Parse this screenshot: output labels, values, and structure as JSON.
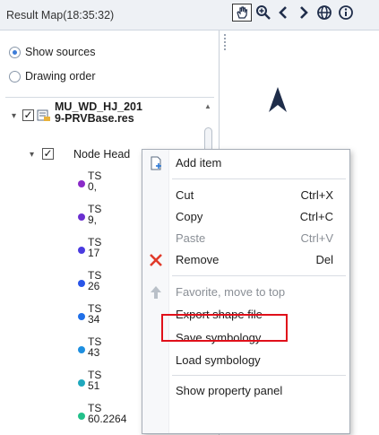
{
  "window": {
    "title": "Result Map(18:35:32)"
  },
  "view_options": {
    "show_sources": "Show sources",
    "drawing_order": "Drawing order",
    "selected": "Show sources"
  },
  "tree": {
    "layer_name_line1": "MU_WD_HJ_201",
    "layer_name_line2": "9-PRVBase.res",
    "node_group": "Node Head",
    "items": [
      {
        "line1": "TS",
        "line2": "0,",
        "color": "#8a2ac8"
      },
      {
        "line1": "TS",
        "line2": "9,",
        "color": "#6a2fd0"
      },
      {
        "line1": "TS",
        "line2": "17",
        "color": "#4a3be0"
      },
      {
        "line1": "TS",
        "line2": "26",
        "color": "#2a55e8"
      },
      {
        "line1": "TS",
        "line2": "34",
        "color": "#1f6fe8"
      },
      {
        "line1": "TS",
        "line2": "43",
        "color": "#1e8fe0"
      },
      {
        "line1": "TS",
        "line2": "51",
        "color": "#1fa8bd"
      },
      {
        "line1": "TS",
        "line2": "60.2264",
        "color": "#22c08a"
      }
    ]
  },
  "toolbar": {
    "tools": [
      "pan-icon",
      "zoom-icon",
      "back-icon",
      "forward-icon",
      "globe-icon",
      "info-icon"
    ]
  },
  "context_menu": {
    "add_item": "Add item",
    "cut": "Cut",
    "cut_shortcut": "Ctrl+X",
    "copy": "Copy",
    "copy_shortcut": "Ctrl+C",
    "paste": "Paste",
    "paste_shortcut": "Ctrl+V",
    "remove": "Remove",
    "remove_shortcut": "Del",
    "favorite": "Favorite, move to top",
    "export_shape": "Export shape file",
    "save_symbology": "Save symbology",
    "load_symbology": "Load symbology",
    "show_property_panel": "Show property panel"
  },
  "colors": {
    "highlight_box": "#e0101a",
    "remove_icon": "#e03a2a",
    "north_arrow": "#1f2d4a"
  }
}
